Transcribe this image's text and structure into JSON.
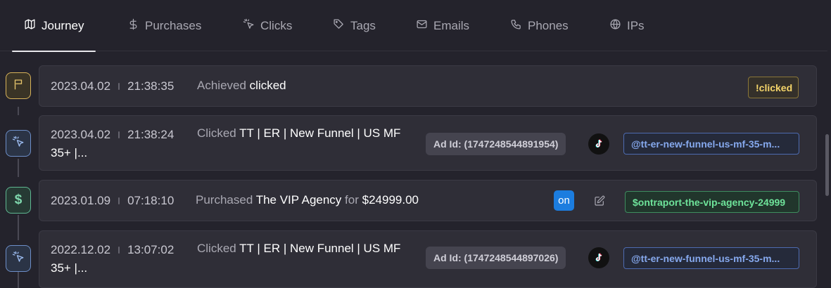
{
  "tabs": [
    {
      "label": "Journey",
      "icon": "map-icon",
      "active": true
    },
    {
      "label": "Purchases",
      "icon": "dollar-icon"
    },
    {
      "label": "Clicks",
      "icon": "pointer-click-icon"
    },
    {
      "label": "Tags",
      "icon": "tag-icon"
    },
    {
      "label": "Emails",
      "icon": "mail-icon"
    },
    {
      "label": "Phones",
      "icon": "phone-icon"
    },
    {
      "label": "IPs",
      "icon": "globe-icon"
    }
  ],
  "events": [
    {
      "type": "flag",
      "date": "2023.04.02",
      "time": "21:38:35",
      "verb": "Achieved",
      "object": "clicked",
      "tag": "!clicked"
    },
    {
      "type": "click",
      "date": "2023.04.02",
      "time": "21:38:24",
      "verb": "Clicked",
      "object_line1": "TT | ER | New Funnel | US MF",
      "object_line2": "35+ |...",
      "ad_id": "Ad Id: (1747248544891954)",
      "tag": "@tt-er-new-funnel-us-mf-35-m..."
    },
    {
      "type": "purchase",
      "date": "2023.01.09",
      "time": "07:18:10",
      "verb": "Purchased",
      "object": "The VIP Agency",
      "for": "for",
      "amount": "$24999.00",
      "on_label": "on",
      "tag": "$ontraport-the-vip-agency-24999"
    },
    {
      "type": "click",
      "date": "2022.12.02",
      "time": "13:07:02",
      "verb": "Clicked",
      "object_line1": "TT | ER | New Funnel | US MF",
      "object_line2": "35+ |...",
      "ad_id": "Ad Id: (1747248544897026)",
      "tag": "@tt-er-new-funnel-us-mf-35-m..."
    }
  ],
  "node_symbols": {
    "money": "$"
  }
}
